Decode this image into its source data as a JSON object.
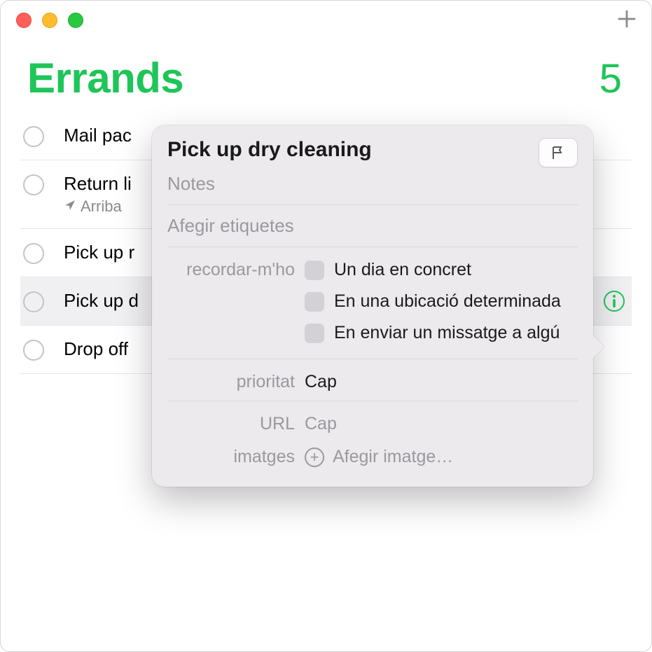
{
  "colors": {
    "accent": "#1ec558"
  },
  "header": {
    "title": "Errands",
    "count": "5"
  },
  "items": [
    {
      "title": "Mail pac",
      "sub": "",
      "selected": false
    },
    {
      "title": "Return li",
      "sub": "Arriba",
      "selected": false,
      "has_location": true
    },
    {
      "title": "Pick up r",
      "sub": "",
      "selected": false
    },
    {
      "title": "Pick up d",
      "sub": "",
      "selected": true,
      "has_info": true
    },
    {
      "title": "Drop off",
      "sub": "",
      "selected": false
    }
  ],
  "popover": {
    "title": "Pick up dry cleaning",
    "notes_placeholder": "Notes",
    "tags_placeholder": "Afegir etiquetes",
    "remind_label": "recordar-m'ho",
    "remind_options": {
      "date": "Un dia en concret",
      "location": "En una ubicació determinada",
      "messaging": "En enviar un missatge a algú"
    },
    "priority_label": "prioritat",
    "priority_value": "Cap",
    "url_label": "URL",
    "url_value": "Cap",
    "images_label": "imatges",
    "add_image": "Afegir imatge…"
  }
}
